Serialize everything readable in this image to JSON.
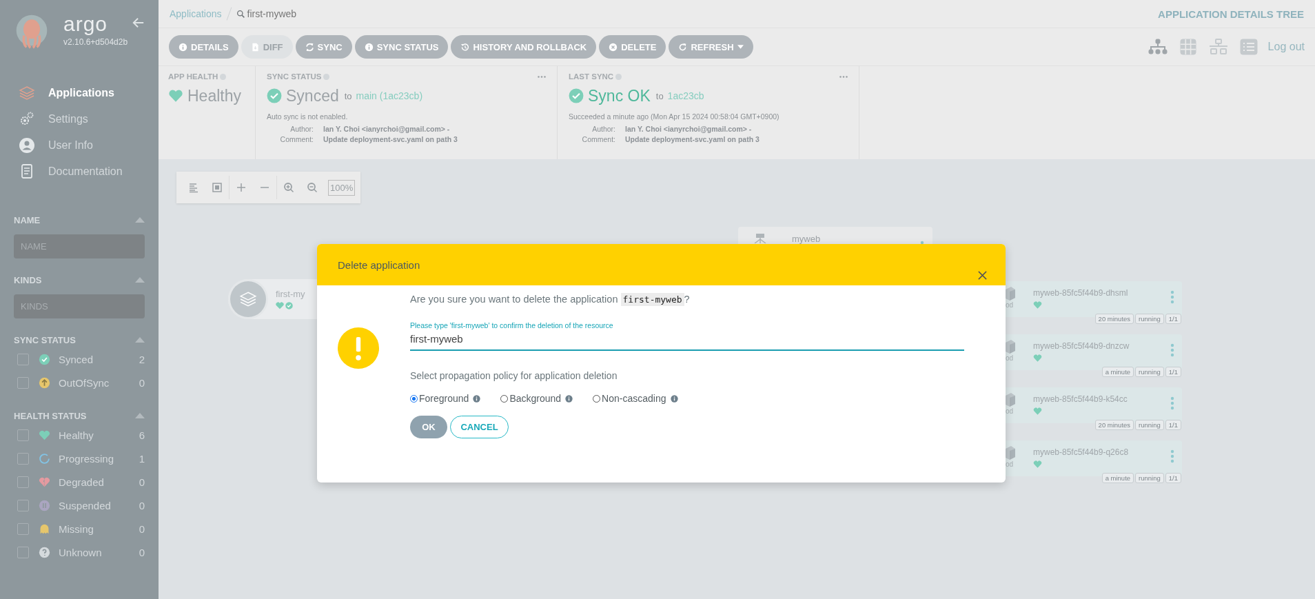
{
  "sidebar": {
    "logo": {
      "name": "argo",
      "version": "v2.10.6+d504d2b"
    },
    "nav": [
      {
        "label": "Applications",
        "selected": true
      },
      {
        "label": "Settings",
        "selected": false
      },
      {
        "label": "User Info",
        "selected": false
      },
      {
        "label": "Documentation",
        "selected": false
      }
    ],
    "filters": [
      {
        "kind": "field",
        "title": "NAME",
        "placeholder": "NAME",
        "expanded": true
      },
      {
        "kind": "field",
        "title": "KINDS",
        "placeholder": "KINDS",
        "expanded": true
      },
      {
        "kind": "checklist",
        "title": "SYNC STATUS",
        "expanded": true,
        "items": [
          {
            "label": "Synced",
            "count": "2",
            "checked": false,
            "kind": "check",
            "color": "#7ccfb8"
          },
          {
            "label": "OutOfSync",
            "count": "0",
            "checked": false,
            "kind": "arrow",
            "color": "#e6c66c"
          }
        ]
      },
      {
        "kind": "checklist",
        "title": "HEALTH STATUS",
        "expanded": true,
        "items": [
          {
            "label": "Healthy",
            "count": "6",
            "checked": false,
            "kind": "heart",
            "color": "#7ccfb8"
          },
          {
            "label": "Progressing",
            "count": "1",
            "checked": false,
            "kind": "ring",
            "color": "#82c4e6"
          },
          {
            "label": "Degraded",
            "count": "0",
            "checked": false,
            "kind": "broken",
            "color": "#e59aa0"
          },
          {
            "label": "Suspended",
            "count": "0",
            "checked": false,
            "kind": "pause",
            "color": "#aaa5c0"
          },
          {
            "label": "Missing",
            "count": "0",
            "checked": false,
            "kind": "ghost",
            "color": "#e6c66c"
          },
          {
            "label": "Unknown",
            "count": "0",
            "checked": false,
            "kind": "question",
            "color": "#d5dadd"
          }
        ]
      }
    ]
  },
  "topbar": {
    "breadcrumb": {
      "parent": "Applications",
      "current": "first-myweb"
    },
    "page_title": "APPLICATION DETAILS TREE",
    "actions": [
      {
        "label": "DETAILS",
        "disabled": false
      },
      {
        "label": "DIFF",
        "disabled": true
      },
      {
        "label": "SYNC",
        "disabled": false
      },
      {
        "label": "SYNC STATUS",
        "disabled": false
      },
      {
        "label": "HISTORY AND ROLLBACK",
        "disabled": false
      },
      {
        "label": "DELETE",
        "disabled": false
      },
      {
        "label": "REFRESH",
        "disabled": false
      }
    ],
    "view_modes": [
      {
        "selected": true
      },
      {
        "selected": false
      },
      {
        "selected": false
      },
      {
        "selected": false
      }
    ],
    "logout": "Log out"
  },
  "status": {
    "app_health": {
      "title": "APP HEALTH",
      "value": "Healthy"
    },
    "sync_status": {
      "title": "SYNC STATUS",
      "value": "Synced",
      "to": "to",
      "revision": "main (1ac23cb)",
      "note": "Auto sync is not enabled.",
      "details": [
        {
          "label": "Author:",
          "value": "Ian Y. Choi <ianyrchoi@gmail.com> -"
        },
        {
          "label": "Comment:",
          "value": "Update deployment-svc.yaml on path 3"
        }
      ]
    },
    "last_sync": {
      "title": "LAST SYNC",
      "value": "Sync OK",
      "to": "to",
      "revision": "1ac23cb",
      "note": "Succeeded a minute ago (Mon Apr 15 2024 00:58:04 GMT+0900)",
      "details": [
        {
          "label": "Author:",
          "value": "Ian Y. Choi <ianyrchoi@gmail.com> -"
        },
        {
          "label": "Comment:",
          "value": "Update deployment-svc.yaml on path 3"
        }
      ]
    }
  },
  "graph": {
    "zoom": "100%",
    "app_node": {
      "name": "first-my"
    },
    "deployment_node": {
      "name": "myweb"
    },
    "pods": [
      {
        "kind_label": "od",
        "name": "myweb-85fc5f44b9-dhsml",
        "tags": [
          "20 minutes",
          "running",
          "1/1"
        ]
      },
      {
        "kind_label": "od",
        "name": "myweb-85fc5f44b9-dnzcw",
        "tags": [
          "a minute",
          "running",
          "1/1"
        ]
      },
      {
        "kind_label": "od",
        "name": "myweb-85fc5f44b9-k54cc",
        "tags": [
          "20 minutes",
          "running",
          "1/1"
        ]
      },
      {
        "kind_label": "od",
        "name": "myweb-85fc5f44b9-q26c8",
        "tags": [
          "a minute",
          "running",
          "1/1"
        ]
      }
    ]
  },
  "dialog": {
    "title": "Delete application",
    "question": {
      "before": "Are you sure you want to delete the application",
      "code": "first-myweb",
      "after": "?"
    },
    "field": {
      "label": "Please type 'first-myweb' to confirm the deletion of the resource",
      "value": "first-myweb"
    },
    "policy_label": "Select propagation policy for application deletion",
    "options": [
      {
        "label": "Foreground",
        "selected": true
      },
      {
        "label": "Background",
        "selected": false
      },
      {
        "label": "Non-cascading",
        "selected": false
      }
    ],
    "ok": "OK",
    "cancel": "CANCEL"
  }
}
